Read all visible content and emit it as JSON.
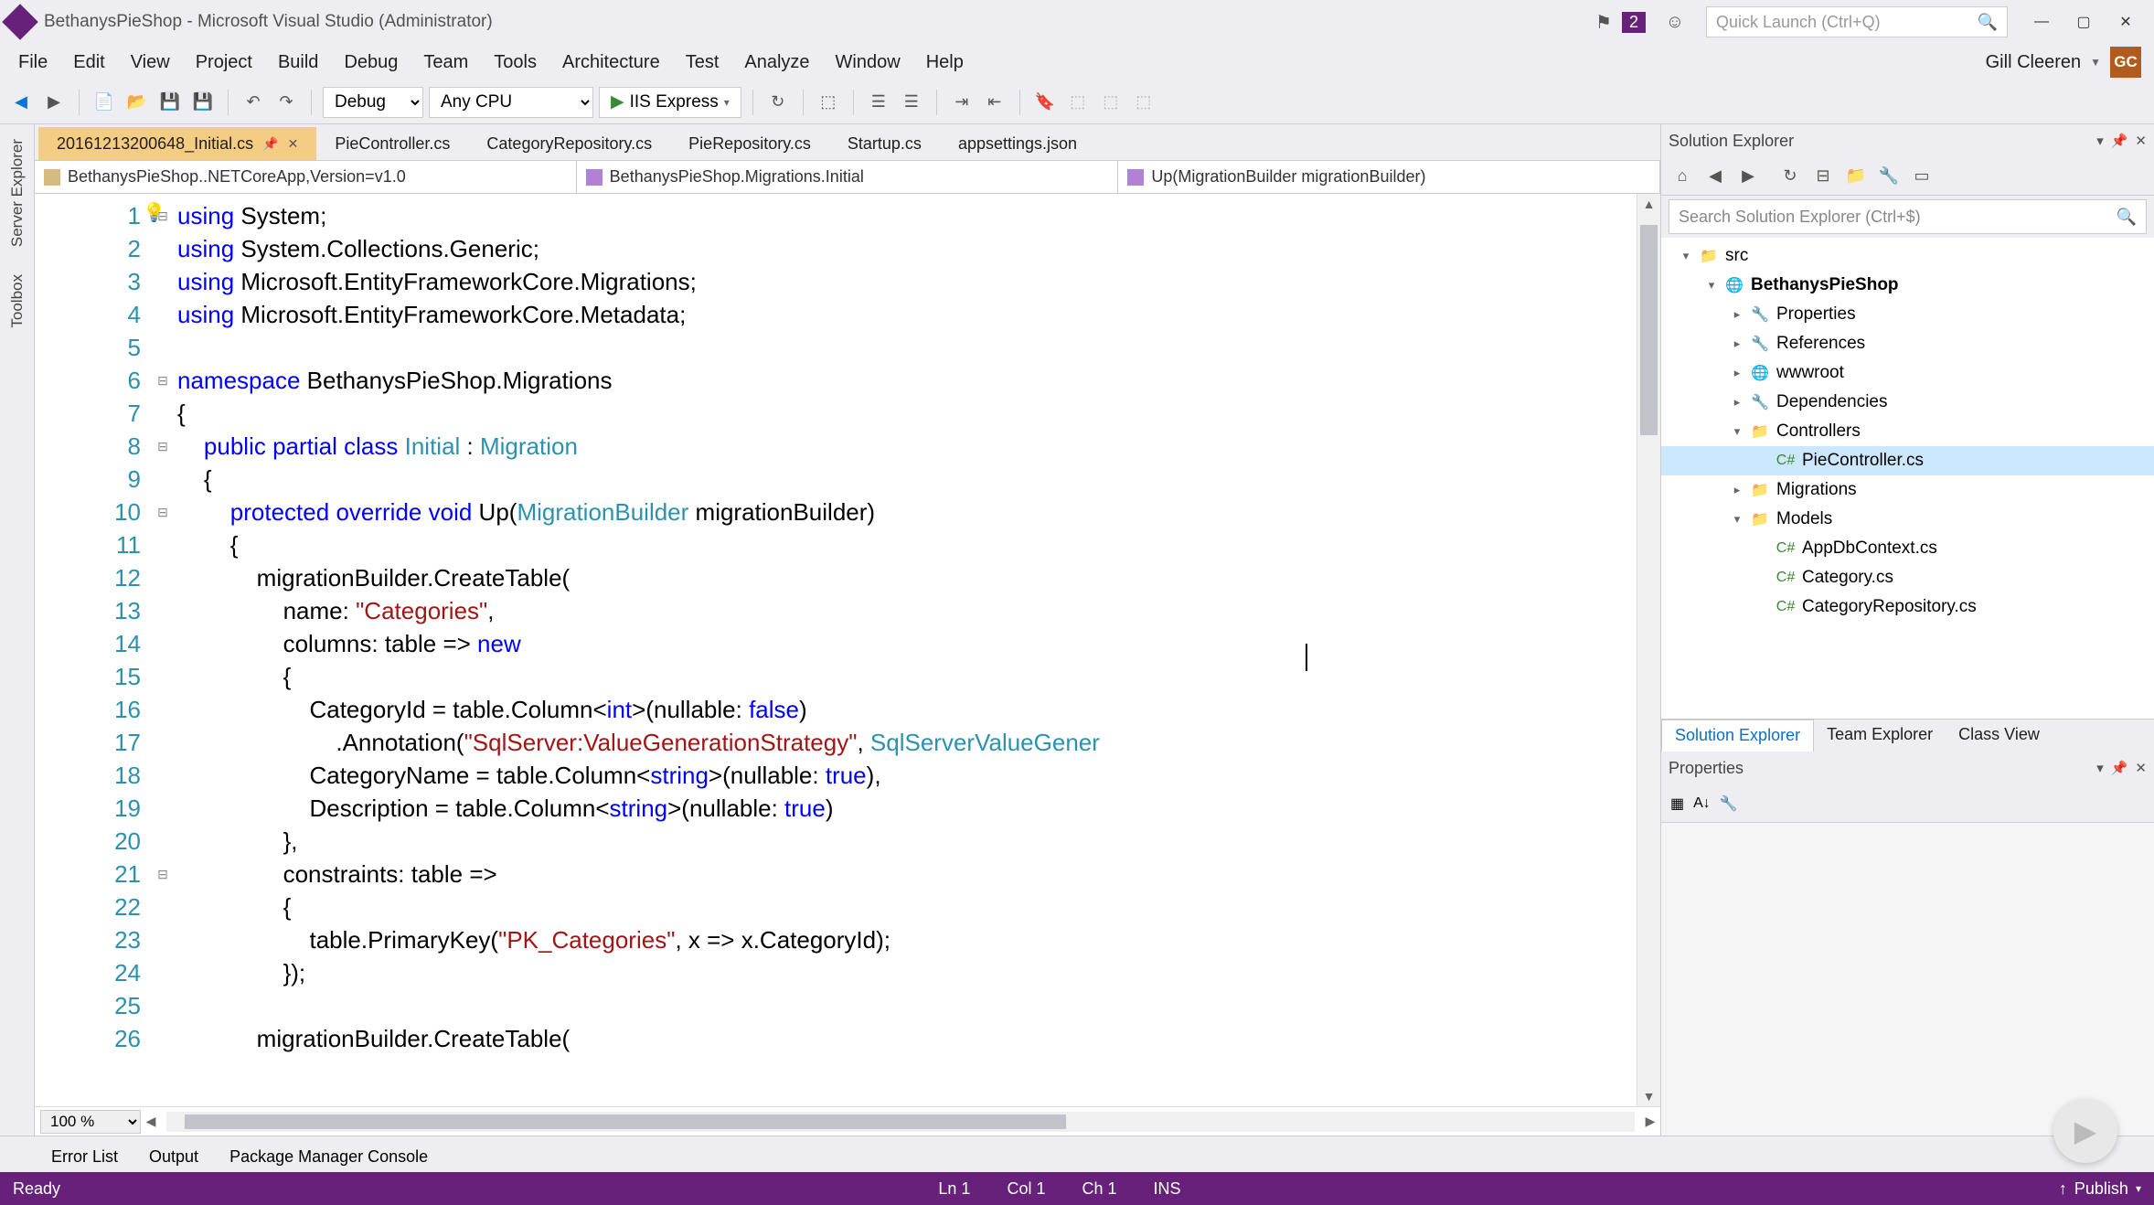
{
  "title": "BethanysPieShop - Microsoft Visual Studio (Administrator)",
  "notification_count": "2",
  "quick_launch_placeholder": "Quick Launch (Ctrl+Q)",
  "menus": [
    "File",
    "Edit",
    "View",
    "Project",
    "Build",
    "Debug",
    "Team",
    "Tools",
    "Architecture",
    "Test",
    "Analyze",
    "Window",
    "Help"
  ],
  "user_name": "Gill Cleeren",
  "user_initials": "GC",
  "toolbar": {
    "config": "Debug",
    "platform": "Any CPU",
    "run_label": "IIS Express"
  },
  "left_rail": [
    "Server Explorer",
    "Toolbox"
  ],
  "doc_tabs": [
    {
      "label": "20161213200648_Initial.cs",
      "active": true
    },
    {
      "label": "PieController.cs",
      "active": false
    },
    {
      "label": "CategoryRepository.cs",
      "active": false
    },
    {
      "label": "PieRepository.cs",
      "active": false
    },
    {
      "label": "Startup.cs",
      "active": false
    },
    {
      "label": "appsettings.json",
      "active": false
    }
  ],
  "navbar": {
    "project": "BethanysPieShop..NETCoreApp,Version=v1.0",
    "class": "BethanysPieShop.Migrations.Initial",
    "method": "Up(MigrationBuilder migrationBuilder)"
  },
  "code_lines": [
    {
      "n": 1,
      "fold": "-",
      "html": "<span class='kw'>using</span> System;"
    },
    {
      "n": 2,
      "fold": "",
      "html": "<span class='kw'>using</span> System.Collections.Generic;"
    },
    {
      "n": 3,
      "fold": "",
      "html": "<span class='kw'>using</span> Microsoft.EntityFrameworkCore.Migrations;"
    },
    {
      "n": 4,
      "fold": "",
      "html": "<span class='kw'>using</span> Microsoft.EntityFrameworkCore.Metadata;"
    },
    {
      "n": 5,
      "fold": "",
      "html": ""
    },
    {
      "n": 6,
      "fold": "-",
      "html": "<span class='kw'>namespace</span> BethanysPieShop.Migrations"
    },
    {
      "n": 7,
      "fold": "",
      "html": "{"
    },
    {
      "n": 8,
      "fold": "-",
      "html": "    <span class='kw'>public</span> <span class='kw'>partial</span> <span class='kw'>class</span> <span class='typ'>Initial</span> : <span class='typ'>Migration</span>"
    },
    {
      "n": 9,
      "fold": "",
      "html": "    {"
    },
    {
      "n": 10,
      "fold": "-",
      "html": "        <span class='kw'>protected</span> <span class='kw'>override</span> <span class='kw'>void</span> Up(<span class='typ'>MigrationBuilder</span> migrationBuilder)"
    },
    {
      "n": 11,
      "fold": "",
      "html": "        {"
    },
    {
      "n": 12,
      "fold": "",
      "html": "            migrationBuilder.CreateTable("
    },
    {
      "n": 13,
      "fold": "",
      "html": "                name: <span class='str'>\"Categories\"</span>,"
    },
    {
      "n": 14,
      "fold": "",
      "html": "                columns: table =&gt; <span class='kw'>new</span>"
    },
    {
      "n": 15,
      "fold": "",
      "html": "                {"
    },
    {
      "n": 16,
      "fold": "",
      "html": "                    CategoryId = table.Column&lt;<span class='kw'>int</span>&gt;(nullable: <span class='kw'>false</span>)"
    },
    {
      "n": 17,
      "fold": "",
      "html": "                        .Annotation(<span class='str'>\"SqlServer:ValueGenerationStrategy\"</span>, <span class='typ'>SqlServerValueGener</span>"
    },
    {
      "n": 18,
      "fold": "",
      "html": "                    CategoryName = table.Column&lt;<span class='kw'>string</span>&gt;(nullable: <span class='kw'>true</span>),"
    },
    {
      "n": 19,
      "fold": "",
      "html": "                    Description = table.Column&lt;<span class='kw'>string</span>&gt;(nullable: <span class='kw'>true</span>)"
    },
    {
      "n": 20,
      "fold": "",
      "html": "                },"
    },
    {
      "n": 21,
      "fold": "-",
      "html": "                constraints: table =&gt;"
    },
    {
      "n": 22,
      "fold": "",
      "html": "                {"
    },
    {
      "n": 23,
      "fold": "",
      "html": "                    table.PrimaryKey(<span class='str'>\"PK_Categories\"</span>, x =&gt; x.CategoryId);"
    },
    {
      "n": 24,
      "fold": "",
      "html": "                });"
    },
    {
      "n": 25,
      "fold": "",
      "html": ""
    },
    {
      "n": 26,
      "fold": "",
      "html": "            migrationBuilder.CreateTable("
    }
  ],
  "zoom": "100 %",
  "solution_explorer": {
    "title": "Solution Explorer",
    "search_placeholder": "Search Solution Explorer (Ctrl+$)",
    "tree": [
      {
        "depth": 0,
        "tw": "▾",
        "icon": "fld",
        "label": "src",
        "bold": false
      },
      {
        "depth": 1,
        "tw": "▾",
        "icon": "gl",
        "label": "BethanysPieShop",
        "bold": true
      },
      {
        "depth": 2,
        "tw": "▸",
        "icon": "wr",
        "label": "Properties",
        "bold": false
      },
      {
        "depth": 2,
        "tw": "▸",
        "icon": "wr",
        "label": "References",
        "bold": false
      },
      {
        "depth": 2,
        "tw": "▸",
        "icon": "gl",
        "label": "wwwroot",
        "bold": false
      },
      {
        "depth": 2,
        "tw": "▸",
        "icon": "wr",
        "label": "Dependencies",
        "bold": false
      },
      {
        "depth": 2,
        "tw": "▾",
        "icon": "fld",
        "label": "Controllers",
        "bold": false
      },
      {
        "depth": 3,
        "tw": "",
        "icon": "cs",
        "label": "PieController.cs",
        "bold": false,
        "selected": true
      },
      {
        "depth": 2,
        "tw": "▸",
        "icon": "fld",
        "label": "Migrations",
        "bold": false
      },
      {
        "depth": 2,
        "tw": "▾",
        "icon": "fld",
        "label": "Models",
        "bold": false
      },
      {
        "depth": 3,
        "tw": "",
        "icon": "cs",
        "label": "AppDbContext.cs",
        "bold": false
      },
      {
        "depth": 3,
        "tw": "",
        "icon": "cs",
        "label": "Category.cs",
        "bold": false
      },
      {
        "depth": 3,
        "tw": "",
        "icon": "cs",
        "label": "CategoryRepository.cs",
        "bold": false
      }
    ],
    "tabs": [
      "Solution Explorer",
      "Team Explorer",
      "Class View"
    ]
  },
  "properties_title": "Properties",
  "bottom_tabs": [
    "Error List",
    "Output",
    "Package Manager Console"
  ],
  "status": {
    "ready": "Ready",
    "ln": "Ln 1",
    "col": "Col 1",
    "ch": "Ch 1",
    "ins": "INS",
    "publish": "Publish"
  }
}
